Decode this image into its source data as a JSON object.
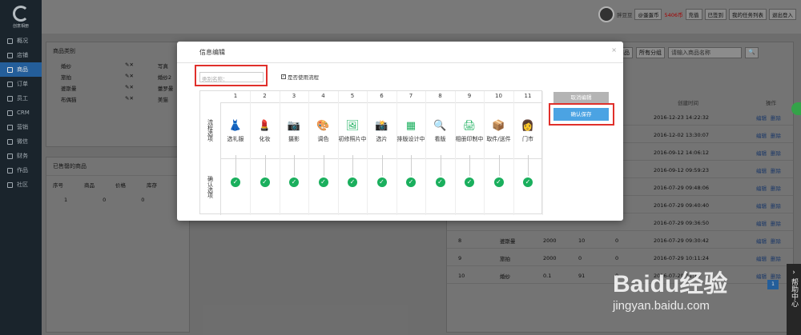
{
  "logo_text": "创意相册",
  "sidebar": {
    "items": [
      {
        "label": "概况"
      },
      {
        "label": "店铺"
      },
      {
        "label": "商品",
        "active": true
      },
      {
        "label": "订单"
      },
      {
        "label": "员工"
      },
      {
        "label": "CRM"
      },
      {
        "label": "营销"
      },
      {
        "label": "微信"
      },
      {
        "label": "财务"
      },
      {
        "label": "作品"
      },
      {
        "label": "社区"
      }
    ]
  },
  "topbar": {
    "user": "胖豆豆",
    "shop": "@蛋蛋币",
    "coins": "5406币",
    "recharge": "充值",
    "signed": "已签到",
    "tasks": "我的任务列表",
    "logout": "退出登入"
  },
  "left_panel": {
    "title": "商品类别",
    "rows": [
      {
        "a": "婚纱",
        "b": "写真"
      },
      {
        "a": "旅拍",
        "b": "婚纱2"
      },
      {
        "a": "婆斯曼",
        "b": "蕾罗曼"
      },
      {
        "a": "布偶猫",
        "b": "美猫"
      }
    ]
  },
  "left_panel2": {
    "title": "已售罄的商品",
    "headers": [
      "序号",
      "商品",
      "价格",
      "库存"
    ],
    "row": [
      "1",
      "0",
      "0",
      "0"
    ]
  },
  "right_panel": {
    "filters": [
      "商品",
      "所有分组"
    ],
    "search_placeholder": "请输入商品名称",
    "headers": [
      "创建时间",
      "操作"
    ],
    "rows": [
      {
        "time": "2016-12-23 14:22:32"
      },
      {
        "time": "2016-12-02 13:30:07"
      },
      {
        "time": "2016-09-12 14:06:12"
      },
      {
        "time": "2016-09-12 09:59:23"
      },
      {
        "time": "2016-07-29 09:48:06"
      },
      {
        "time": "2016-07-29 09:40:40"
      },
      {
        "time": "2016-07-29 09:36:50"
      },
      {
        "id": "8",
        "name": "婆斯曼",
        "price": "2000",
        "stock": "10",
        "sold": "0",
        "time": "2016-07-29 09:30:42"
      },
      {
        "id": "9",
        "name": "旅拍",
        "price": "2000",
        "stock": "0",
        "sold": "0",
        "time": "2016-07-29 10:11:24"
      },
      {
        "id": "10",
        "name": "婚纱",
        "price": "0.1",
        "stock": "91",
        "sold": "0",
        "time": "2016-07-29 11:19"
      }
    ],
    "action_edit": "编辑",
    "action_delete": "删除",
    "page": "1"
  },
  "modal": {
    "title": "信息编辑",
    "close": "×",
    "category_placeholder": "类别名称：",
    "use_process_label": "是否使用流程",
    "row_process_label": "流程选项",
    "row_confirm_label": "确认选项",
    "cancel_label": "取消编辑",
    "save_label": "确认保存",
    "steps": [
      {
        "num": "1",
        "label": "选礼服",
        "icon": "dress-icon",
        "glyph": "👗"
      },
      {
        "num": "2",
        "label": "化妆",
        "icon": "makeup-icon",
        "glyph": "💄"
      },
      {
        "num": "3",
        "label": "摄影",
        "icon": "camera-icon",
        "glyph": "📷"
      },
      {
        "num": "4",
        "label": "调色",
        "icon": "palette-icon",
        "glyph": "🎨"
      },
      {
        "num": "5",
        "label": "初修照片中",
        "icon": "photo-icon",
        "glyph": "🖼"
      },
      {
        "num": "6",
        "label": "选片",
        "icon": "select-photo-icon",
        "glyph": "📸"
      },
      {
        "num": "7",
        "label": "排版设计中",
        "icon": "layout-icon",
        "glyph": "▦"
      },
      {
        "num": "8",
        "label": "看版",
        "icon": "review-icon",
        "glyph": "🔍"
      },
      {
        "num": "9",
        "label": "相册印制中",
        "icon": "print-icon",
        "glyph": "🖨"
      },
      {
        "num": "10",
        "label": "取件/送件",
        "icon": "package-icon",
        "glyph": "📦"
      },
      {
        "num": "11",
        "label": "门市",
        "icon": "store-icon",
        "glyph": "👩"
      }
    ]
  },
  "help": "帮助中心",
  "watermark": {
    "brand": "Baidu经验",
    "url": "jingyan.baidu.com"
  },
  "colors": {
    "accent": "#4ba3e3",
    "check": "#1aaf5d",
    "highlight": "#e0302b"
  }
}
